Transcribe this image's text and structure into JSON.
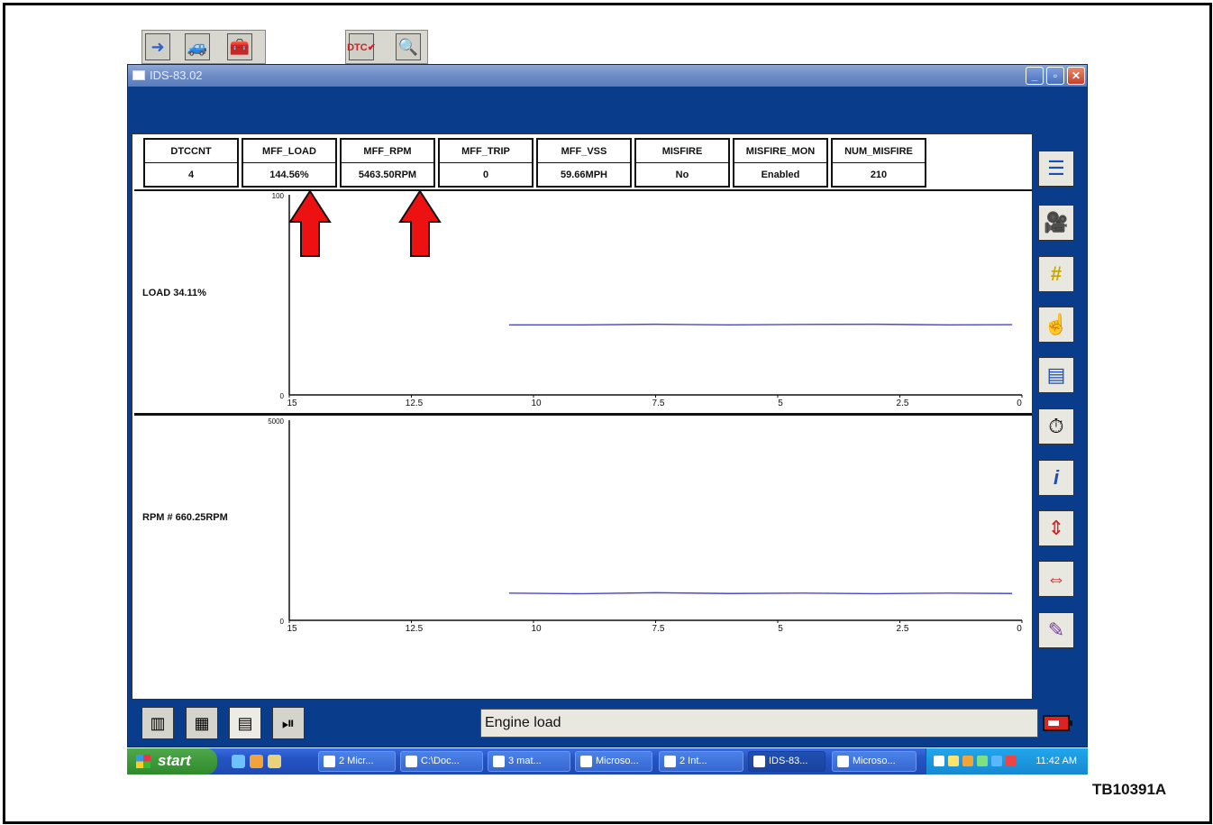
{
  "window": {
    "title": "IDS-83.02"
  },
  "pids": [
    {
      "name": "DTCCNT",
      "value": "4"
    },
    {
      "name": "MFF_LOAD",
      "value": "144.56%"
    },
    {
      "name": "MFF_RPM",
      "value": "5463.50RPM"
    },
    {
      "name": "MFF_TRIP",
      "value": "0"
    },
    {
      "name": "MFF_VSS",
      "value": "59.66MPH"
    },
    {
      "name": "MISFIRE",
      "value": "No"
    },
    {
      "name": "MISFIRE_MON",
      "value": "Enabled"
    },
    {
      "name": "NUM_MISFIRE",
      "value": "210"
    }
  ],
  "graphs": {
    "load": {
      "label": "LOAD  34.11%",
      "ymax": "100",
      "ymin": "0"
    },
    "rpm": {
      "label": "RPM #  660.25RPM",
      "ymax": "5000",
      "ymin": "0"
    },
    "xticks": [
      "15",
      "12.5",
      "10",
      "7.5",
      "5",
      "2.5",
      "0"
    ]
  },
  "chart_data": [
    {
      "type": "line",
      "ylim": [
        0,
        100
      ],
      "xlim": [
        15,
        0
      ],
      "x": [
        10.5,
        9,
        7.5,
        6,
        4.5,
        3,
        1.5,
        0.2
      ],
      "series": [
        {
          "values": [
            35,
            35,
            35.3,
            35,
            35.2,
            35.3,
            35,
            35.1
          ]
        }
      ],
      "ylabel": "LOAD  34.11%",
      "tick_labels": [
        "15",
        "12.5",
        "10",
        "7.5",
        "5",
        "2.5",
        "0"
      ]
    },
    {
      "type": "line",
      "ylim": [
        0,
        5000
      ],
      "xlim": [
        15,
        0
      ],
      "x": [
        10.5,
        9,
        7.5,
        6,
        4.5,
        3,
        1.5,
        0.2
      ],
      "series": [
        {
          "values": [
            680,
            665,
            690,
            670,
            680,
            665,
            680,
            670
          ]
        }
      ],
      "ylabel": "RPM #  660.25RPM",
      "tick_labels": [
        "15",
        "12.5",
        "10",
        "7.5",
        "5",
        "2.5",
        "0"
      ]
    }
  ],
  "status": {
    "text": "Engine load"
  },
  "taskbar": {
    "start": "start",
    "tasks": [
      "2 Micr...",
      "C:\\Doc...",
      "3 mat...",
      "Microso...",
      "2 Int...",
      "IDS-83...",
      "Microso..."
    ],
    "clock": "11:42 AM"
  },
  "caption": "TB10391A",
  "colors": {
    "window_bg": "#0a3c8c",
    "trace": "#4a4acc",
    "arrow": "#e11"
  }
}
